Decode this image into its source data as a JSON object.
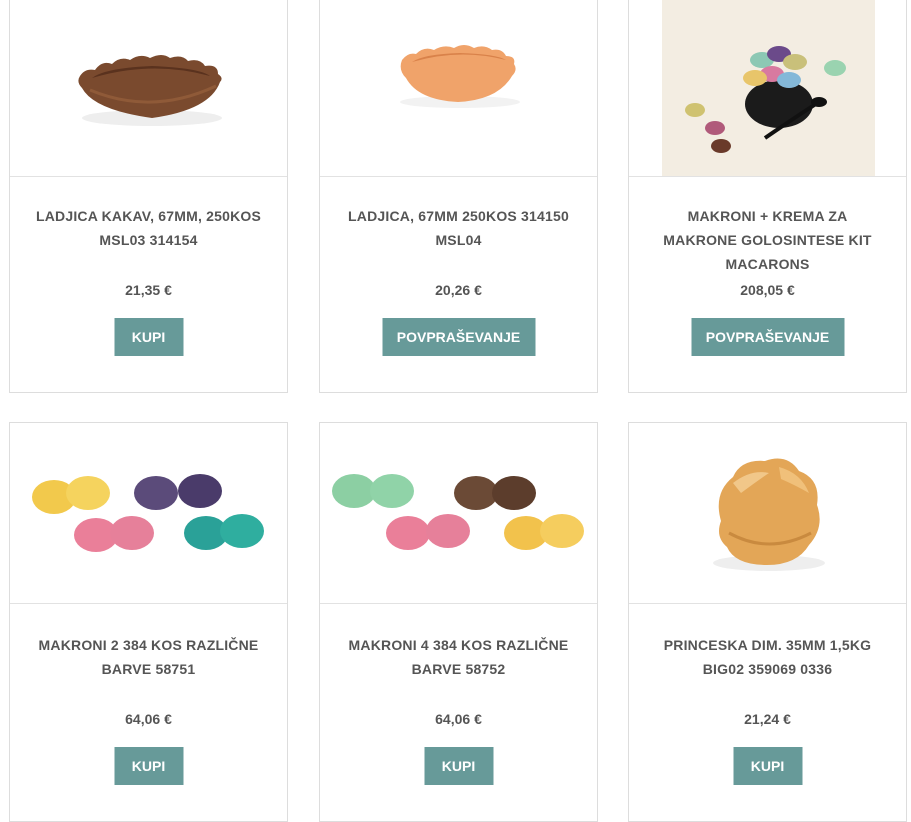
{
  "products": [
    {
      "title_l1": "LADJICA KAKAV, 67MM, 250KOS",
      "title_l2": "MSL03 314154",
      "title_l3": "",
      "price": "21,35 €",
      "button": "KUPI",
      "image": "cocoa-tart-shell-image"
    },
    {
      "title_l1": "LADJICA, 67MM 250KOS 314150",
      "title_l2": "MSL04",
      "title_l3": "",
      "price": "20,26 €",
      "button": "POVPRAŠEVANJE",
      "image": "plain-tart-shell-image"
    },
    {
      "title_l1": "MAKRONI + KREMA ZA",
      "title_l2": "MAKRONE GOLOSINTESE KIT",
      "title_l3": "MACARONS",
      "price": "208,05 €",
      "button": "POVPRAŠEVANJE",
      "image": "macarons-bowl-image"
    },
    {
      "title_l1": "MAKRONI 2 384 KOS RAZLIČNE",
      "title_l2": "BARVE 58751",
      "title_l3": "",
      "price": "64,06 €",
      "button": "KUPI",
      "image": "macarons-assorted-image"
    },
    {
      "title_l1": "MAKRONI 4 384 KOS RAZLIČNE",
      "title_l2": "BARVE 58752",
      "title_l3": "",
      "price": "64,06 €",
      "button": "KUPI",
      "image": "macarons-assorted-image"
    },
    {
      "title_l1": "PRINCESKA DIM. 35MM 1,5KG",
      "title_l2": "BIG02 359069 0336",
      "title_l3": "",
      "price": "21,24 €",
      "button": "KUPI",
      "image": "cream-puff-image"
    }
  ],
  "colors": {
    "button_bg": "#679a99",
    "text": "#555555",
    "border": "#dddddd"
  }
}
